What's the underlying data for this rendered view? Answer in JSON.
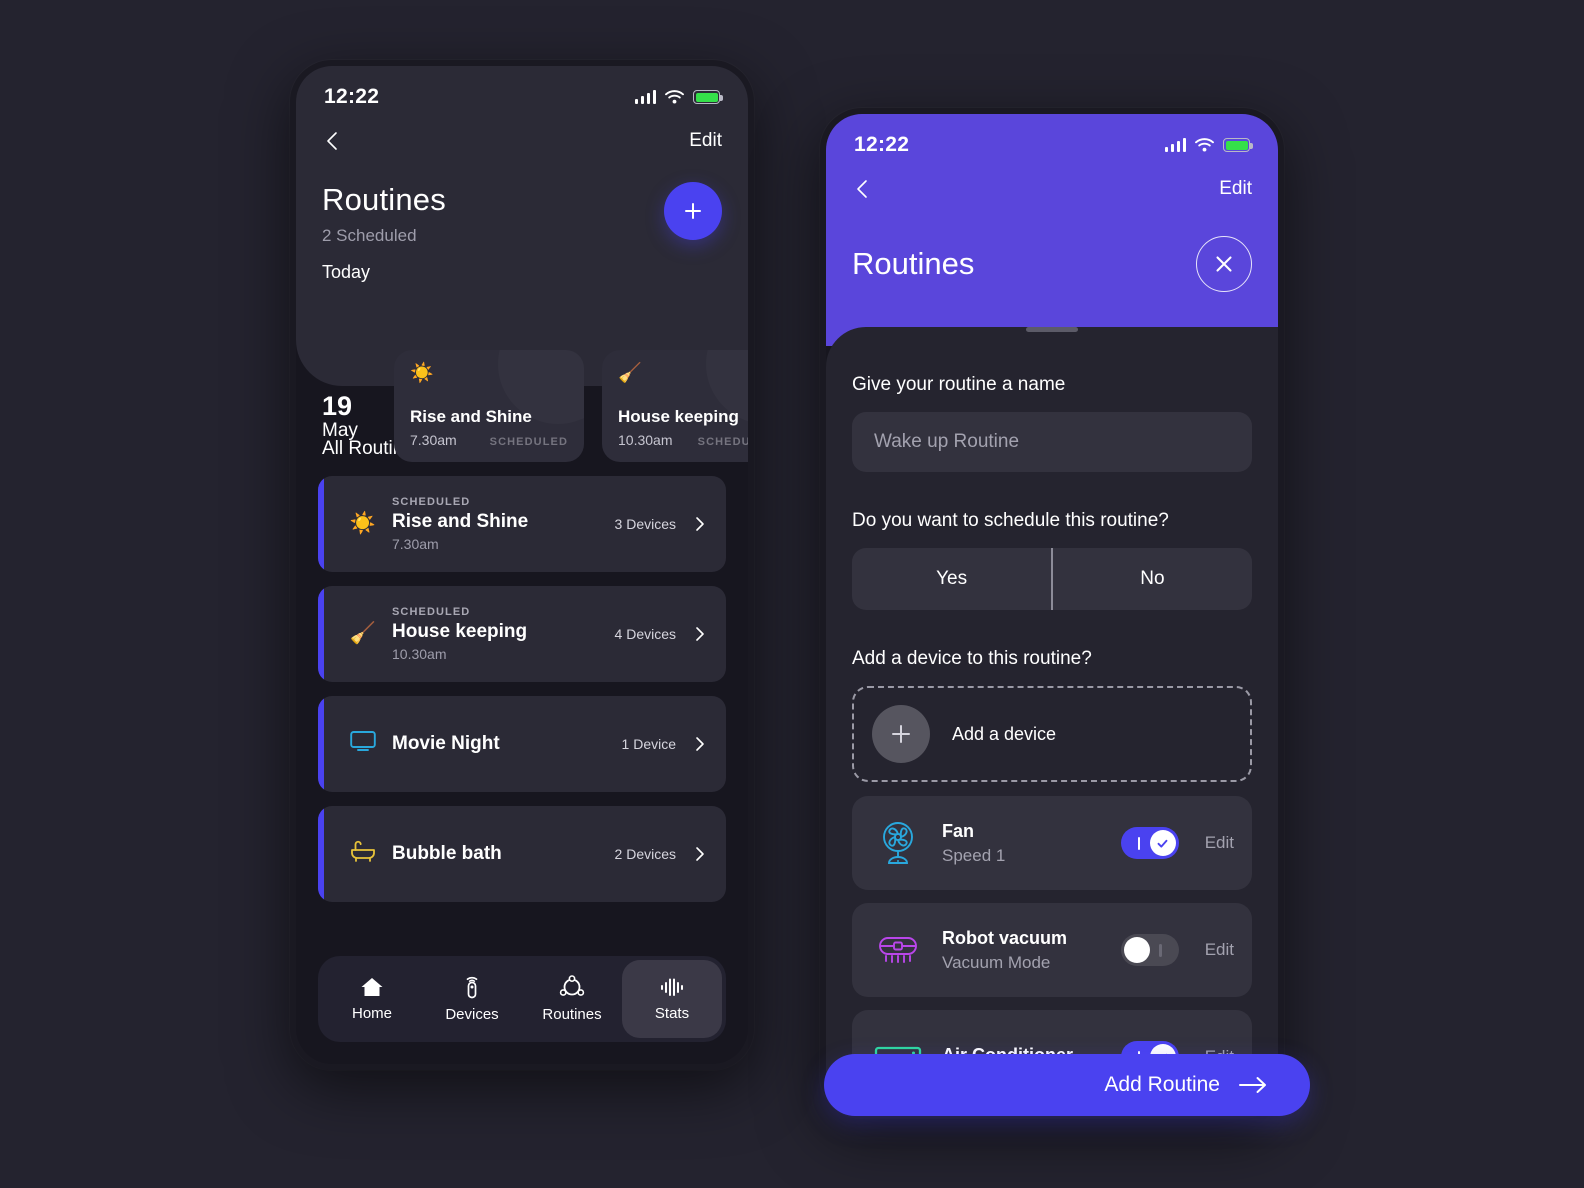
{
  "theme": {
    "accent_blue": "#4a42f0",
    "header_purple": "#5a46db",
    "page_bg": "#24232f",
    "screen_bg": "#17161f",
    "card_bg": "#2b2a36"
  },
  "left_phone": {
    "status": {
      "time": "12:22",
      "signal_icon": "signal-bars-icon",
      "wifi_icon": "wifi-icon",
      "battery_icon": "battery-icon"
    },
    "nav": {
      "back_icon": "chevron-left-icon",
      "edit_label": "Edit"
    },
    "header": {
      "title": "Routines",
      "subtitle": "2 Scheduled",
      "add_icon": "plus-icon"
    },
    "today": {
      "label": "Today",
      "day": "19",
      "month": "May",
      "cards": [
        {
          "icon": "sun-icon",
          "name": "Rise and Shine",
          "time": "7.30am",
          "tag": "SCHEDULED"
        },
        {
          "icon": "broom-icon",
          "name": "House keeping",
          "time": "10.30am",
          "tag": "SCHEDULED"
        }
      ]
    },
    "all_routines": {
      "section_title": "All Routines",
      "items": [
        {
          "tag": "SCHEDULED",
          "icon": "sun-icon",
          "name": "Rise and Shine",
          "time": "7.30am",
          "devices": "3 Devices"
        },
        {
          "tag": "SCHEDULED",
          "icon": "broom-icon",
          "name": "House keeping",
          "time": "10.30am",
          "devices": "4 Devices"
        },
        {
          "tag": "",
          "icon": "tv-icon",
          "name": "Movie Night",
          "time": "",
          "devices": "1 Device"
        },
        {
          "tag": "",
          "icon": "bathtub-icon",
          "name": "Bubble bath",
          "time": "",
          "devices": "2 Devices"
        }
      ]
    },
    "tabbar": {
      "items": [
        {
          "label": "Home",
          "icon": "home-icon",
          "active": false
        },
        {
          "label": "Devices",
          "icon": "remote-icon",
          "active": false
        },
        {
          "label": "Routines",
          "icon": "routines-icon",
          "active": false
        },
        {
          "label": "Stats",
          "icon": "stats-icon",
          "active": true
        }
      ]
    }
  },
  "right_phone": {
    "status": {
      "time": "12:22",
      "signal_icon": "signal-bars-icon",
      "wifi_icon": "wifi-icon",
      "battery_icon": "battery-icon"
    },
    "nav": {
      "back_icon": "chevron-left-icon",
      "edit_label": "Edit"
    },
    "header": {
      "title": "Routines",
      "close_icon": "close-icon"
    },
    "form": {
      "name_label": "Give your routine  a name",
      "name_placeholder": "Wake up Routine",
      "schedule_question": "Do you want to schedule this routine?",
      "schedule_options": [
        "Yes",
        "No"
      ],
      "device_question": "Add a device to this routine?",
      "add_device_label": "Add a device",
      "add_device_icon": "plus-icon"
    },
    "devices": [
      {
        "icon": "fan-icon",
        "name": "Fan",
        "mode": "Speed 1",
        "toggle": "on",
        "edit_label": "Edit"
      },
      {
        "icon": "robot-vacuum-icon",
        "name": "Robot vacuum",
        "mode": "Vacuum Mode",
        "toggle": "off",
        "edit_label": "Edit"
      },
      {
        "icon": "air-conditioner-icon",
        "name": "Air Conditioner",
        "mode": "",
        "toggle": "on",
        "edit_label": "Edit"
      }
    ],
    "submit": {
      "label": "Add Routine",
      "icon": "arrow-right-icon"
    }
  }
}
